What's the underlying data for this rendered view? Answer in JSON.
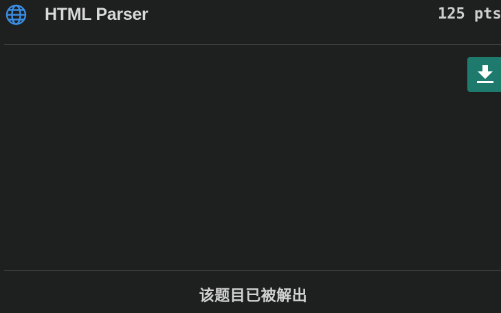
{
  "challenge": {
    "title": "HTML Parser",
    "points": "125 pts",
    "category_icon": "globe-icon",
    "download_icon": "download-icon",
    "accent_color": "#1e7a6c",
    "icon_color": "#3a8ee6"
  },
  "footer": {
    "status_text": "该题目已被解出"
  }
}
